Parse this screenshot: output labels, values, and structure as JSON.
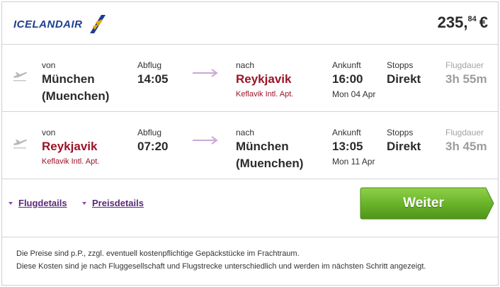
{
  "header": {
    "airline_logo_text": "ICELANDAIR",
    "price_main": "235,",
    "price_cents": "84",
    "price_currency": "€"
  },
  "flights": [
    {
      "from_label": "von",
      "from_city_line1": "München",
      "from_city_line2": "(Muenchen)",
      "from_airport": "",
      "departure_label": "Abflug",
      "departure_time": "14:05",
      "to_label": "nach",
      "to_city_line1": "Reykjavik",
      "to_city_line2": "",
      "to_airport": "Keflavik Intl. Apt.",
      "arrival_label": "Ankunft",
      "arrival_time": "16:00",
      "arrival_date": "Mon 04 Apr",
      "stops_label": "Stopps",
      "stops_value": "Direkt",
      "duration_label": "Flugdauer",
      "duration_value": "3h 55m"
    },
    {
      "from_label": "von",
      "from_city_line1": "Reykjavik",
      "from_city_line2": "",
      "from_airport": "Keflavik Intl. Apt.",
      "departure_label": "Abflug",
      "departure_time": "07:20",
      "to_label": "nach",
      "to_city_line1": "München",
      "to_city_line2": "(Muenchen)",
      "to_airport": "",
      "arrival_label": "Ankunft",
      "arrival_time": "13:05",
      "arrival_date": "Mon 11 Apr",
      "stops_label": "Stopps",
      "stops_value": "Direkt",
      "duration_label": "Flugdauer",
      "duration_value": "3h 45m"
    }
  ],
  "actions": {
    "flight_details_label": "Flugdetails",
    "price_details_label": "Preisdetails",
    "continue_label": "Weiter"
  },
  "notice": {
    "line1": "Die Preise sind p.P., zzgl. eventuell kostenpflichtige Gepäckstücke im Frachtraum.",
    "line2": "Diese Kosten sind je nach Fluggesellschaft und Flugstrecke unterschiedlich und werden im nächsten Schritt angezeigt."
  },
  "colors": {
    "brand_blue": "#1d3f8f",
    "brand_gold": "#f0a800",
    "accent_red": "#9b1325",
    "link_purple": "#5b2a7a",
    "button_green": "#6ab42a"
  },
  "icons": {
    "airline_logo": "icelandair-logo",
    "plane": "plane-takeoff-icon",
    "arrow": "right-arrow-icon",
    "toggle": "triangle-down-icon"
  }
}
